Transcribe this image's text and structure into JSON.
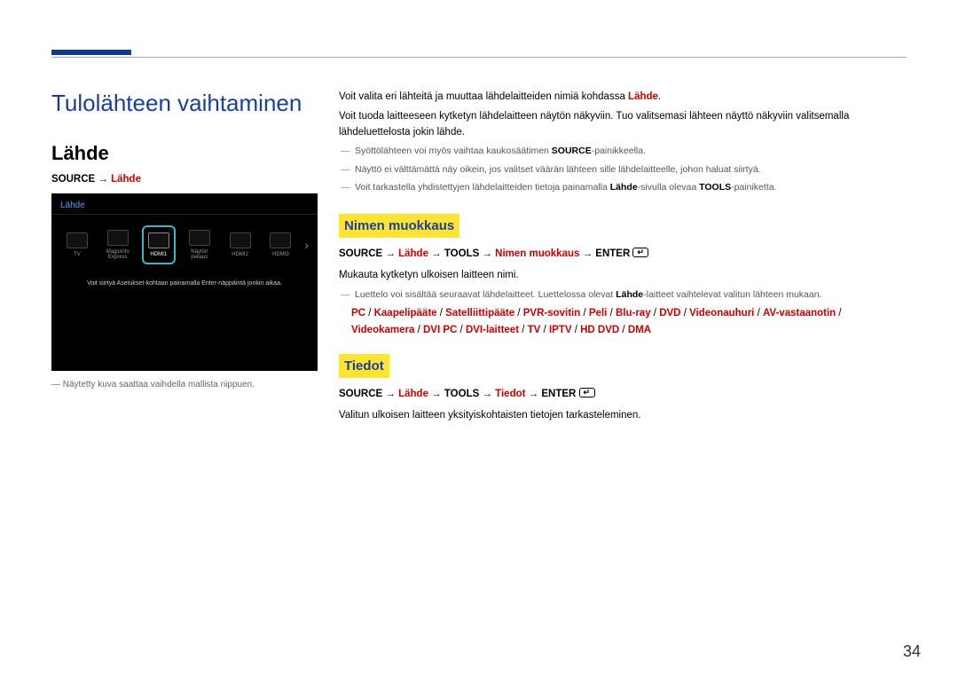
{
  "page_number": "34",
  "h1": "Tulolähteen vaihtaminen",
  "h2": "Lähde",
  "breadcrumb_left": {
    "source": "SOURCE",
    "arrow": " → ",
    "lahde": "Lähde"
  },
  "screenshot": {
    "title": "Lähde",
    "items": [
      "TV",
      "MagicInfo Express",
      "HDMI1",
      "Näytön peilaus",
      "HDMI2",
      "HDMI3"
    ],
    "caption": "Voit siirtyä Asetukset-kohtaan painamalla Enter-näppäintä jonkin aikaa."
  },
  "footnote": "― Näytetty kuva saattaa vaihdella mallista riippuen.",
  "intro": {
    "p1a": "Voit valita eri lähteitä ja muuttaa lähdelaitteiden nimiä kohdassa ",
    "p1b": "Lähde",
    "p1c": ".",
    "p2": "Voit tuoda laitteeseen kytketyn lähdelaitteen näytön näkyviin. Tuo valitsemasi lähteen näyttö näkyviin valitsemalla lähdeluettelosta jokin lähde.",
    "d1a": "Syöttölähteen voi myös vaihtaa kaukosäätimen ",
    "d1b": "SOURCE",
    "d1c": "-painikkeella.",
    "d2": "Näyttö ei välttämättä näy oikein, jos valitset väärän lähteen sille lähdelaitteelle, johon haluat siirtyä.",
    "d3a": "Voit tarkastella yhdistettyjen lähdelaitteiden tietoja painamalla ",
    "d3b": "Lähde",
    "d3c": "-sivulla olevaa ",
    "d3d": "TOOLS",
    "d3e": "-painiketta."
  },
  "nimen": {
    "head": "Nimen muokkaus",
    "path": {
      "p1": "SOURCE",
      "p2": " → ",
      "p3": "Lähde",
      "p4": " → ",
      "p5": "TOOLS",
      "p6": " → ",
      "p7": "Nimen muokkaus",
      "p8": " → ",
      "p9": "ENTER"
    },
    "line1": "Mukauta kytketyn ulkoisen laitteen nimi.",
    "dash_a": "Luettelo voi sisältää seuraavat lähdelaitteet. Luettelossa olevat ",
    "dash_b": "Lähde",
    "dash_c": "-laitteet vaihtelevat valitun lähteen mukaan.",
    "list1": [
      "PC",
      "Kaapelipääte",
      "Satelliittipääte",
      "PVR-sovitin",
      "Peli",
      "Blu-ray",
      "DVD",
      "Videonauhuri",
      "AV-vastaanotin"
    ],
    "list2": [
      "Videokamera",
      "DVI PC",
      "DVI-laitteet",
      "TV",
      "IPTV",
      "HD DVD",
      "DMA"
    ]
  },
  "tiedot": {
    "head": "Tiedot",
    "path": {
      "p1": "SOURCE",
      "p2": " → ",
      "p3": "Lähde",
      "p4": " → ",
      "p5": "TOOLS",
      "p6": " → ",
      "p7": "Tiedot",
      "p8": " → ",
      "p9": "ENTER"
    },
    "line1": "Valitun ulkoisen laitteen yksityiskohtaisten tietojen tarkasteleminen."
  }
}
